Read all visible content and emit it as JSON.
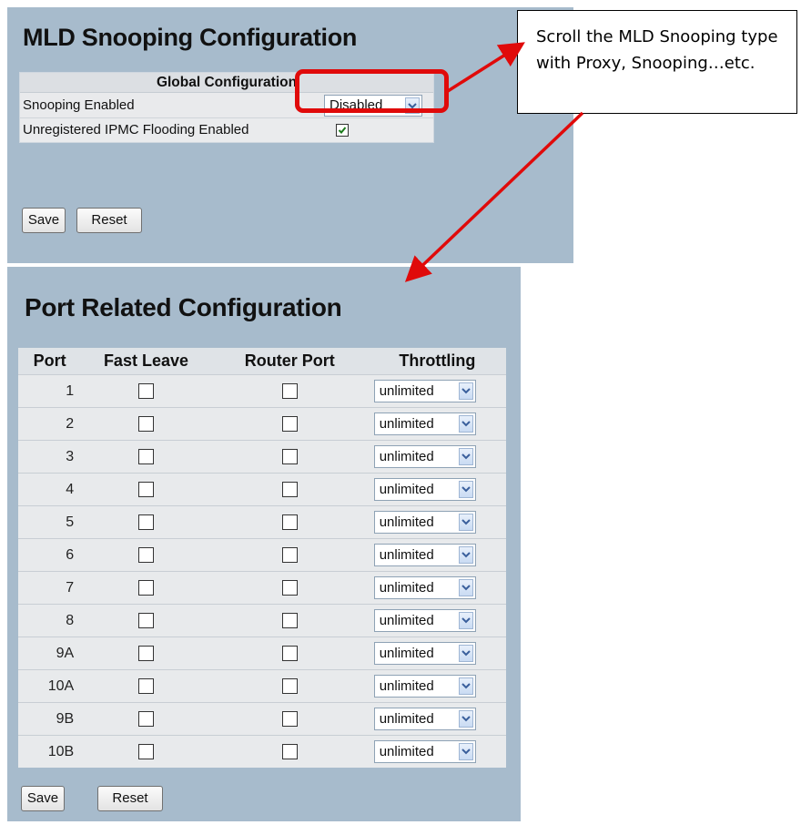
{
  "global": {
    "title": "MLD Snooping Configuration",
    "section_header": "Global Configuration",
    "snooping_enabled_label": "Snooping Enabled",
    "snooping_enabled_value": "Disabled",
    "flooding_label": "Unregistered IPMC Flooding Enabled",
    "flooding_checked": true,
    "save_label": "Save",
    "reset_label": "Reset"
  },
  "port": {
    "title": "Port Related Configuration",
    "columns": [
      "Port",
      "Fast Leave",
      "Router Port",
      "Throttling"
    ],
    "rows": [
      {
        "port": "1",
        "fast_leave": false,
        "router_port": false,
        "throttling": "unlimited"
      },
      {
        "port": "2",
        "fast_leave": false,
        "router_port": false,
        "throttling": "unlimited"
      },
      {
        "port": "3",
        "fast_leave": false,
        "router_port": false,
        "throttling": "unlimited"
      },
      {
        "port": "4",
        "fast_leave": false,
        "router_port": false,
        "throttling": "unlimited"
      },
      {
        "port": "5",
        "fast_leave": false,
        "router_port": false,
        "throttling": "unlimited"
      },
      {
        "port": "6",
        "fast_leave": false,
        "router_port": false,
        "throttling": "unlimited"
      },
      {
        "port": "7",
        "fast_leave": false,
        "router_port": false,
        "throttling": "unlimited"
      },
      {
        "port": "8",
        "fast_leave": false,
        "router_port": false,
        "throttling": "unlimited"
      },
      {
        "port": "9A",
        "fast_leave": false,
        "router_port": false,
        "throttling": "unlimited"
      },
      {
        "port": "10A",
        "fast_leave": false,
        "router_port": false,
        "throttling": "unlimited"
      },
      {
        "port": "9B",
        "fast_leave": false,
        "router_port": false,
        "throttling": "unlimited"
      },
      {
        "port": "10B",
        "fast_leave": false,
        "router_port": false,
        "throttling": "unlimited"
      }
    ],
    "save_label": "Save",
    "reset_label": "Reset"
  },
  "callout": {
    "text": "Scroll the MLD Snooping type with Proxy, Snooping…etc."
  },
  "colors": {
    "panel_bg": "#a7bbcc",
    "highlight": "#e00a0a"
  }
}
